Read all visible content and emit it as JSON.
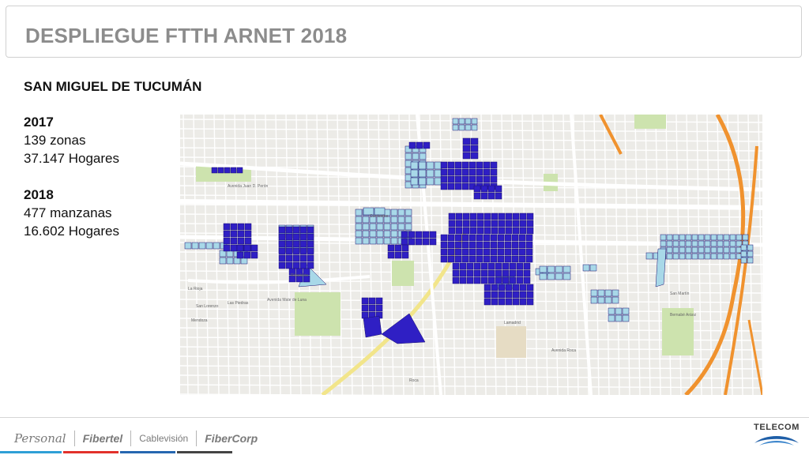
{
  "header": {
    "title": "DESPLIEGUE FTTH ARNET 2018"
  },
  "info": {
    "city": "SAN MIGUEL DE TUCUMÁN",
    "y2017": {
      "year": "2017",
      "zonas": "139 zonas",
      "hogares": "37.147 Hogares"
    },
    "y2018": {
      "year": "2018",
      "manzanas": "477 manzanas",
      "hogares": "16.602 Hogares"
    }
  },
  "map": {
    "labels": [
      "Avenida Juan D. Perón",
      "Mendoza",
      "La Rioja",
      "San Lorenzo",
      "Avenida Mate de Luna",
      "Las Piedras",
      "Rivadavia",
      "San Martín",
      "Bernabé Aráoz",
      "Roca",
      "Lamadrid",
      "Corrientes",
      "Avenida Roca"
    ],
    "colors": {
      "zone_2017": "#a8d8e8",
      "manzana_2018": "#2f1fc4",
      "highway": "#f0922e",
      "avenue": "#f2e58a",
      "park": "#cde3ae"
    }
  },
  "footer": {
    "brands": [
      "Personal",
      "Fibertel",
      "Cablevisión",
      "FiberCorp"
    ],
    "company": "TELECOM",
    "colors": {
      "personal": "#2f9fd6",
      "fibertel": "#e2312b",
      "cablevision": "#2667b0",
      "fibercorp": "#444444",
      "telecom": "#1f5fa8"
    }
  }
}
